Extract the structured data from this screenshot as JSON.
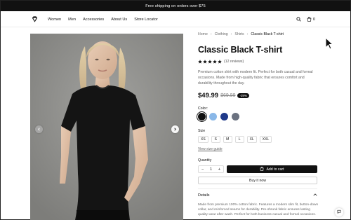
{
  "announcement": "Free shipping on orders over $75",
  "nav": [
    "Women",
    "Men",
    "Accessories",
    "About Us",
    "Store Locator"
  ],
  "header_icons": {
    "search": "search-icon",
    "cart": "bag-icon",
    "cart_count": "0",
    "logo": "diamond-logo-icon"
  },
  "breadcrumbs": [
    "Home",
    "Clothing",
    "Shirts",
    "Classic Black T-shirt"
  ],
  "product": {
    "title": "Classic Black T-shirt",
    "rating": 5,
    "reviews": "(12 reviews)",
    "description": "Premium cotton shirt with modern fit. Perfect for both casual and formal occasions. Made from high-quality fabric that ensures comfort and durability throughout the day.",
    "price": "$49.99",
    "old_price": "$69.99",
    "discount": "-29%"
  },
  "color": {
    "label": "Color:",
    "swatches": [
      "#111111",
      "#8ab8e8",
      "#1f3a8a",
      "#6b7280"
    ],
    "selected": 0
  },
  "size": {
    "label": "Size",
    "options": [
      "XS",
      "S",
      "M",
      "L",
      "XL",
      "XXL"
    ],
    "guide": "View size guide"
  },
  "quantity": {
    "label": "Quantity",
    "value": "1",
    "minus": "−",
    "plus": "+"
  },
  "actions": {
    "add_to_cart": "Add to cart",
    "buy_now": "Buy it now"
  },
  "details": {
    "title": "Details",
    "body": "Made from premium 100% cotton fabric. Features a modern slim fit, button-down collar, and reinforced seams for durability. Pre-shrunk fabric ensures lasting quality wear after wash. Perfect for both business casual and formal occasions."
  },
  "colors": {
    "accent": "#111111",
    "gallery_bg": "#8f8f8c",
    "star": "#111111"
  }
}
